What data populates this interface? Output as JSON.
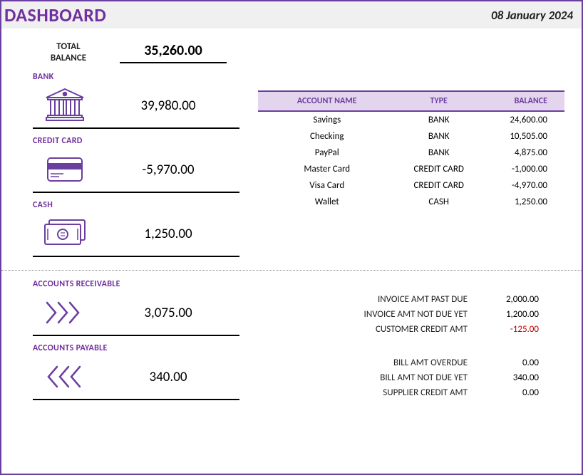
{
  "header": {
    "title": "DASHBOARD",
    "date": "08 January 2024"
  },
  "total": {
    "label1": "TOTAL",
    "label2": "BALANCE",
    "value": "35,260.00"
  },
  "balances": {
    "bank": {
      "label": "BANK",
      "value": "39,980.00"
    },
    "credit": {
      "label": "CREDIT CARD",
      "value": "-5,970.00"
    },
    "cash": {
      "label": "CASH",
      "value": "1,250.00"
    }
  },
  "accounts": {
    "headers": {
      "name": "ACCOUNT NAME",
      "type": "TYPE",
      "balance": "BALANCE"
    },
    "rows": [
      {
        "name": "Savings",
        "type": "BANK",
        "balance": "24,600.00"
      },
      {
        "name": "Checking",
        "type": "BANK",
        "balance": "10,505.00"
      },
      {
        "name": "PayPal",
        "type": "BANK",
        "balance": "4,875.00"
      },
      {
        "name": "Master Card",
        "type": "CREDIT CARD",
        "balance": "-1,000.00"
      },
      {
        "name": "Visa Card",
        "type": "CREDIT CARD",
        "balance": "-4,970.00"
      },
      {
        "name": "Wallet",
        "type": "CASH",
        "balance": "1,250.00"
      }
    ]
  },
  "receivable": {
    "label": "ACCOUNTS RECEIVABLE",
    "value": "3,075.00",
    "items": [
      {
        "k": "INVOICE AMT PAST DUE",
        "v": "2,000.00",
        "neg": false
      },
      {
        "k": "INVOICE AMT NOT DUE YET",
        "v": "1,200.00",
        "neg": false
      },
      {
        "k": "CUSTOMER CREDIT AMT",
        "v": "-125.00",
        "neg": true
      }
    ]
  },
  "payable": {
    "label": "ACCOUNTS PAYABLE",
    "value": "340.00",
    "items": [
      {
        "k": "BILL AMT OVERDUE",
        "v": "0.00",
        "neg": false
      },
      {
        "k": "BILL AMT NOT DUE YET",
        "v": "340.00",
        "neg": false
      },
      {
        "k": "SUPPLIER CREDIT AMT",
        "v": "0.00",
        "neg": false
      }
    ]
  }
}
